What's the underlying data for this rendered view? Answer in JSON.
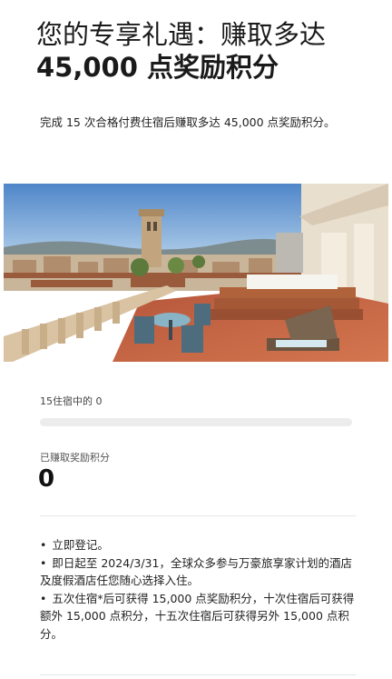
{
  "header": {
    "title_line1": "您的专享礼遇：赚取多达",
    "title_line2": "45,000 点奖励积分"
  },
  "offer": {
    "description": "完成 15 次合格付费住宿后赚取多达 45,000 点奖励积分。"
  },
  "hero_image": {
    "alt": "rooftop-terrace-photo"
  },
  "progress": {
    "label": "15住宿中的 0",
    "completed": 0,
    "total": 15,
    "fill_color": "#c8a35a",
    "track_color": "#ececec"
  },
  "points": {
    "label": "已赚取奖励积分",
    "value": "0"
  },
  "details": {
    "bullets": [
      "立即登记。",
      "即日起至 2024/3/31，全球众多参与万豪旅享家计划的酒店及度假酒店任您随心选择入住。",
      "五次住宿*后可获得 15,000 点奖励积分，十次住宿后可获得额外 15,000 点积分，十五次住宿后可获得另外 15,000 点积分。"
    ]
  }
}
